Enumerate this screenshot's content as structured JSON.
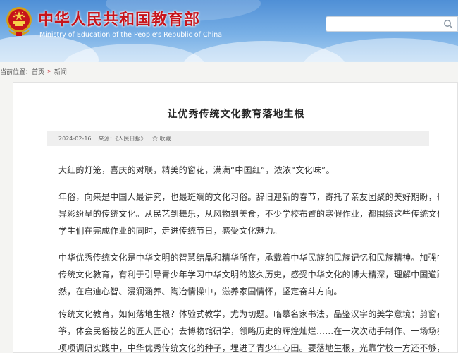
{
  "header": {
    "title_cn": "中华人民共和国教育部",
    "title_en": "Ministry of Education of the People's Republic of China",
    "search": {
      "value": "",
      "placeholder": ""
    },
    "colors": {
      "brand_red": "#c7141b",
      "sky": "#5b97da"
    }
  },
  "breadcrumb": {
    "label": "当前位置：",
    "items": [
      "首页",
      "新闻"
    ]
  },
  "article": {
    "title": "让优秀传统文化教育落地生根",
    "meta": {
      "date": "2024-02-16",
      "source": "来源：《人民日报》",
      "favorite_label": "收藏"
    },
    "paragraphs": [
      [
        "大红的灯笼，喜庆的对联，精美的窗花，满满“中国红”，浓浓“文化味”。"
      ],
      [
        "年俗，向来是中国人最讲究，也最斑斓的文化习俗。辞旧迎新的春节，寄托了亲友团聚的美好期盼，也孕育出",
        "异彩纷呈的传统文化。从民艺到舞乐，从风物到美食，不少学校布置的寒假作业，都围绕这些传统文化意蕴展开。",
        "学生们在完成作业的同时，走进传统节日，感受文化魅力。"
      ],
      [
        "中华优秀传统文化是中华文明的智慧结晶和精华所在，承载着中华民族的民族记忆和民族精神。加强中华优秀",
        "传统文化教育，有利于引导青少年学习中华文明的悠久历史，感受中华文化的博大精深，理解中国道路的历史必",
        "然，在启迪心智、浸润涵养、陶冶情操中，滋养家国情怀，坚定奋斗方向。"
      ],
      [
        "传统文化教育，如何落地生根？体验式教学，尤为切题。临摹名家书法，品鉴汉字的美学意境；剪窗花、扎风",
        "筝，体会民俗技艺的匠人匠心；去博物馆研学，领略历史的辉煌灿烂……在一次次动手制作、一场场参观体验、一",
        "项项调研实践中，中华优秀传统文化的种子，埋进了青少年心田。要落地生根，光靠学校一方还不够，既要充分发"
      ]
    ]
  }
}
